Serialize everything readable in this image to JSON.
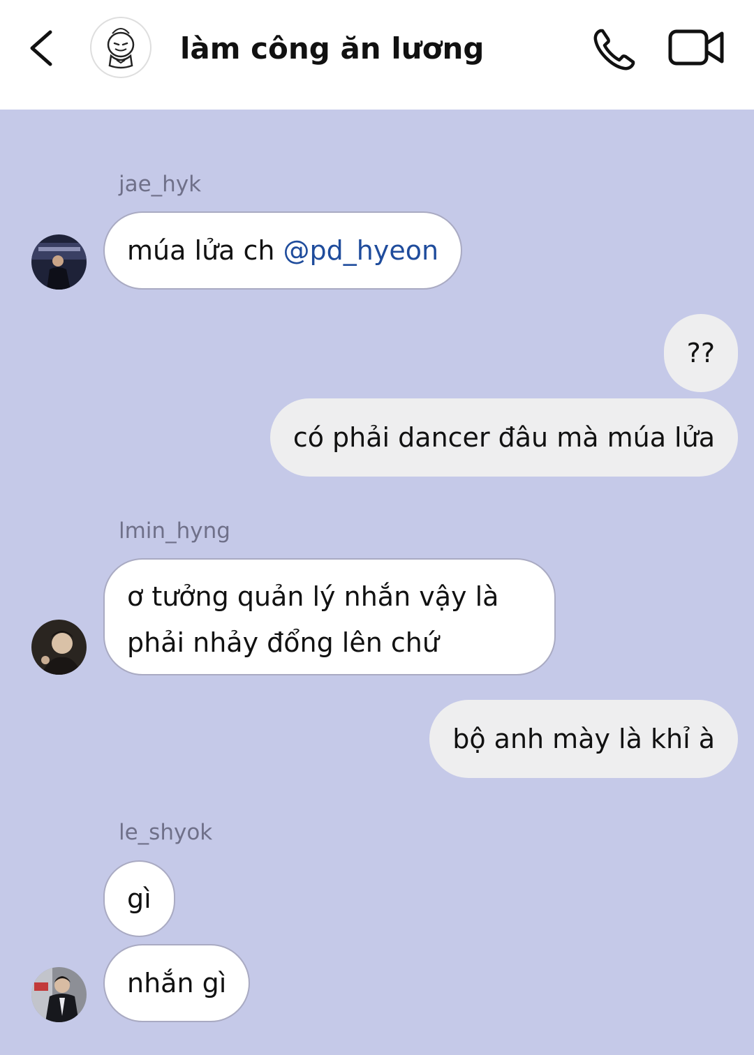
{
  "header": {
    "title": "làm công ăn lương"
  },
  "messages": [
    {
      "sender": "jae_hyk",
      "text": "múa lửa ch ",
      "mention": "@pd_hyeon"
    },
    {
      "text": "??"
    },
    {
      "text": "có phải dancer đâu mà múa lửa"
    },
    {
      "sender": "lmin_hyng",
      "line1": "ơ tưởng quản lý nhắn vậy là",
      "line2": "phải nhảy đổng lên chứ"
    },
    {
      "text": "bộ anh mày là khỉ à"
    },
    {
      "sender": "le_shyok",
      "text": "gì"
    },
    {
      "text": "nhắn gì"
    }
  ],
  "icons": {
    "back": "chevron-left-icon",
    "call": "phone-icon",
    "video": "video-camera-icon"
  },
  "colors": {
    "chat_background": "#c5c9e8",
    "mention": "#1f4c9c",
    "outgoing_bubble": "#eeeeef",
    "incoming_bubble": "#ffffff"
  }
}
